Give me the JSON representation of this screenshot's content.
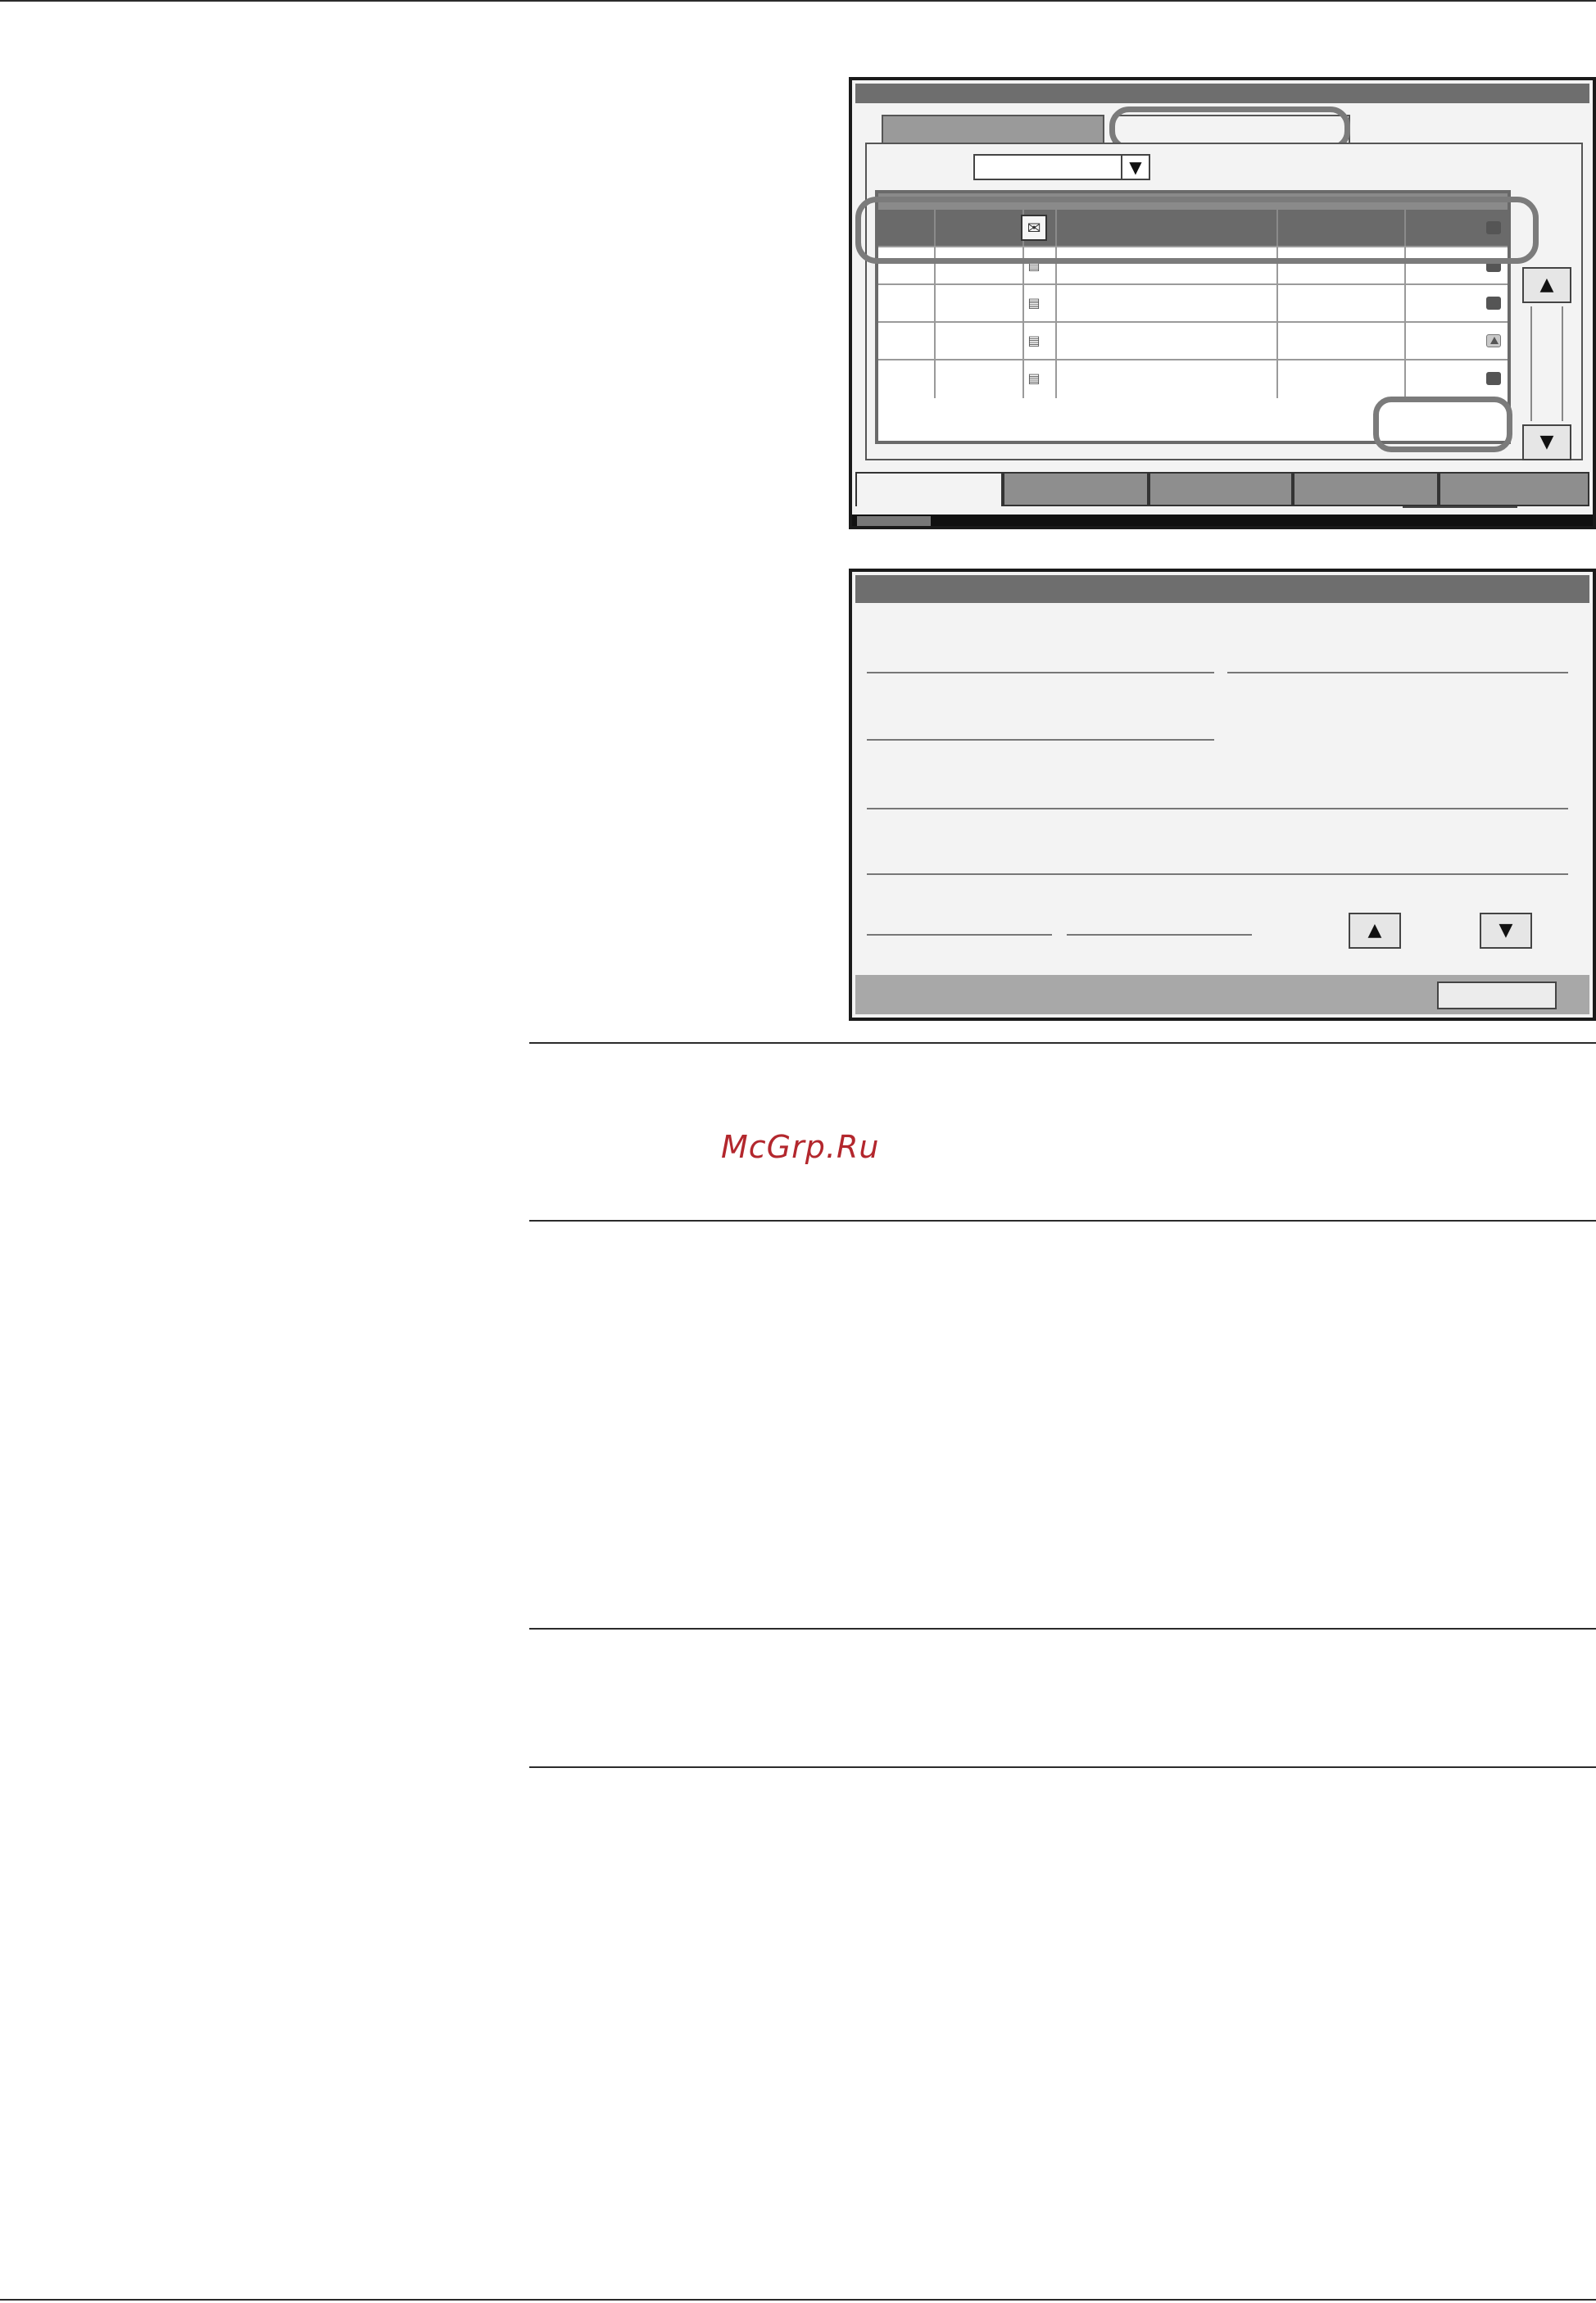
{
  "watermark": {
    "text": "McGrp.Ru",
    "color": "#b3272d"
  },
  "job_status_screen": {
    "dropdown_arrow_glyph": "▼",
    "scroll_up_glyph": "▲",
    "scroll_down_glyph": "▼",
    "rows": [
      {
        "icon": "send-job-icon",
        "status": "ok",
        "selected": true
      },
      {
        "icon": "document-icon",
        "status": "ok",
        "selected": false
      },
      {
        "icon": "document-icon",
        "status": "ok",
        "selected": false
      },
      {
        "icon": "document-icon",
        "status": "warning",
        "selected": false
      },
      {
        "icon": "document-icon",
        "status": "ok",
        "selected": false
      }
    ]
  },
  "detail_screen": {
    "up_glyph": "▲",
    "down_glyph": "▼"
  },
  "colors": {
    "titlebar": "#6e6e6e",
    "selected_row": "#6a6a6a",
    "highlight_outline": "#7b7b7b"
  }
}
